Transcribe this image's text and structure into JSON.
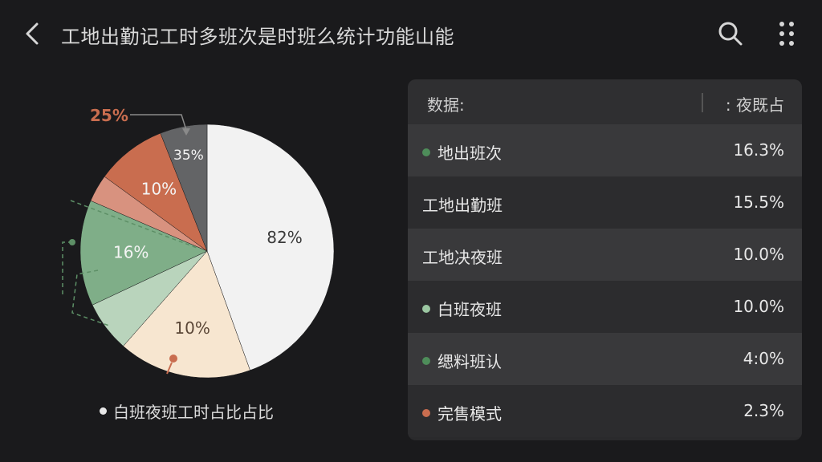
{
  "header": {
    "title": "工地出勤记工时多班次是时班么统计功能山能",
    "back_icon": "chevron-left-icon",
    "search_icon": "search-icon",
    "more_icon": "more-vertical-icon"
  },
  "chart_data": {
    "type": "pie",
    "title": "",
    "slices": [
      {
        "label": "82%",
        "value": 44.5,
        "color": "#f2f2f2"
      },
      {
        "label": "10%",
        "value": 17.0,
        "color": "#f7e6d0"
      },
      {
        "label": "",
        "value": 6.5,
        "color": "#b9d4bc"
      },
      {
        "label": "16%",
        "value": 13.5,
        "color": "#7fae88"
      },
      {
        "label": "",
        "value": 3.5,
        "color": "#d8927f"
      },
      {
        "label": "10%",
        "value": 9.0,
        "color": "#c96d4f"
      },
      {
        "label": "35%",
        "value": 6.0,
        "color": "#636466"
      }
    ],
    "callouts": [
      {
        "label": "25%",
        "color": "#c96d4f"
      }
    ],
    "legend": "白班夜班工时占比占比"
  },
  "table": {
    "header_left": "数据:",
    "header_right": ": 夜既占",
    "rows": [
      {
        "label": "地出班次",
        "value": "16.3%",
        "dot_color": "#4e8d5a"
      },
      {
        "label": "工地出勤班",
        "value": "15.5%",
        "dot_color": ""
      },
      {
        "label": "工地决夜班",
        "value": "10.0%",
        "dot_color": ""
      },
      {
        "label": "白班夜班",
        "value": "10.0%",
        "dot_color": "#9cc7a2"
      },
      {
        "label": "缌料班认",
        "value": "4:0%",
        "dot_color": "#4e8d5a"
      },
      {
        "label": "完售模式",
        "value": "2.3%",
        "dot_color": "#c96d4f"
      }
    ]
  }
}
